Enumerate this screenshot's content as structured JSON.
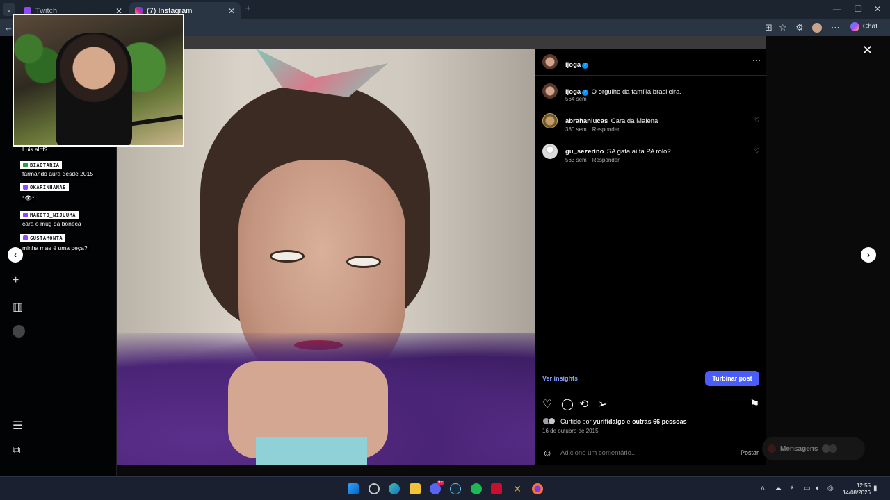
{
  "browser": {
    "tabs": [
      {
        "label": "Twitch",
        "active": false
      },
      {
        "label": "(7) Instagram",
        "active": true
      }
    ],
    "chat_label": "Chat"
  },
  "stream_chat": [
    {
      "user": "",
      "message": "Luis alof?"
    },
    {
      "user": "BIAOTARIA",
      "message": "farmando aura desde 2015",
      "badge_color": "#2ea043"
    },
    {
      "user": "OKARINHANAE",
      "message": "*👁*",
      "badge_color": "#9146ff"
    },
    {
      "user": "MAKOTO_NIJUUMA",
      "message": "cara o mug da boneca",
      "badge_color": "#9146ff"
    },
    {
      "user": "GUSTAMONTA",
      "message": "minha mae é uma peça?",
      "badge_color": "#9146ff"
    }
  ],
  "post": {
    "owner": "ljoga",
    "caption_user": "ljoga",
    "caption": "O orgulho da família brasileira.",
    "caption_age": "564 sem",
    "comments": [
      {
        "user": "abrahanlucas",
        "text": "Cara da Malena",
        "age": "380 sem",
        "reply": "Responder"
      },
      {
        "user": "gu_sezerino",
        "text": "SA gata ai ta PA rolo?",
        "age": "563 sem",
        "reply": "Responder"
      }
    ],
    "insights_label": "Ver insights",
    "boost_label": "Turbinar post",
    "liked_prefix": "Curtido por ",
    "liked_user": "yurifidalgo",
    "liked_middle": " e ",
    "liked_others": "outras 66 pessoas",
    "date": "16 de outubro de 2015",
    "comment_placeholder": "Adicione um comentário...",
    "post_label": "Postar"
  },
  "messages_label": "Mensagens",
  "taskbar": {
    "time": "12:55",
    "date": "14/08/2026",
    "discord_badge": "9+"
  },
  "colors": {
    "accent": "#4a5df9",
    "link": "#85a1ff",
    "verified": "#0095f6"
  }
}
